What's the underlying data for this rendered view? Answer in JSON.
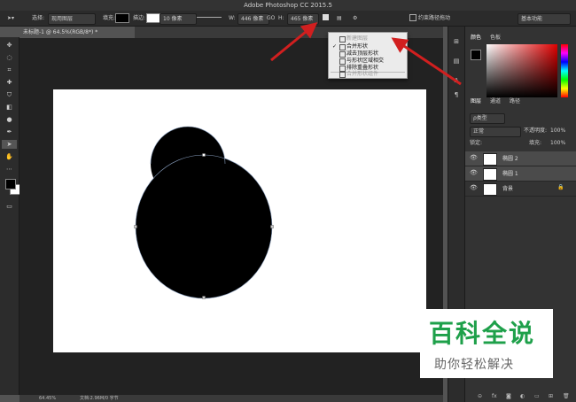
{
  "window": {
    "title": "Adobe Photoshop CC 2015.5"
  },
  "options_bar": {
    "select_label": "选择:",
    "select_value": "现用图层",
    "fill_label": "填充:",
    "stroke_label": "描边:",
    "stroke_width": "10 像素",
    "w_label": "W:",
    "w_value": "446 像素",
    "link_label": "GO",
    "h_label": "H:",
    "h_value": "465 像素",
    "constrain_label": "约束路径拖动",
    "workspace": "基本功能"
  },
  "document": {
    "tab_label": "未标题-1 @ 64.5%(RGB/8*) *",
    "zoom": "64.45%",
    "file_info": "文档:2.96M/0 字节"
  },
  "path_ops_menu": {
    "items": [
      {
        "label": "新建图层",
        "checked": false,
        "disabled": true
      },
      {
        "label": "合并形状",
        "checked": true,
        "disabled": false
      },
      {
        "label": "减去顶层形状",
        "checked": false,
        "disabled": false
      },
      {
        "label": "与形状区域相交",
        "checked": false,
        "disabled": false
      },
      {
        "label": "排除重叠形状",
        "checked": false,
        "disabled": false
      },
      {
        "label": "合并形状组件",
        "checked": false,
        "disabled": true
      }
    ]
  },
  "panels": {
    "color_tabs": [
      "颜色",
      "色板"
    ],
    "layer_tabs": [
      "图层",
      "通道",
      "路径"
    ],
    "filter_label": "ρ类型",
    "blend_mode": "正常",
    "opacity_label": "不透明度:",
    "opacity_value": "100%",
    "lock_label": "锁定:",
    "fill_label": "填充:",
    "fill_value": "100%",
    "layers": [
      {
        "name": "椭圆 2",
        "selected": true
      },
      {
        "name": "椭圆 1",
        "selected": true
      },
      {
        "name": "背景",
        "selected": false
      }
    ]
  },
  "watermark": {
    "main": "百科全说",
    "sub": "助你轻松解决"
  },
  "colors": {
    "accent_green": "#1ea04a",
    "arrow_red": "#d11f1f"
  }
}
